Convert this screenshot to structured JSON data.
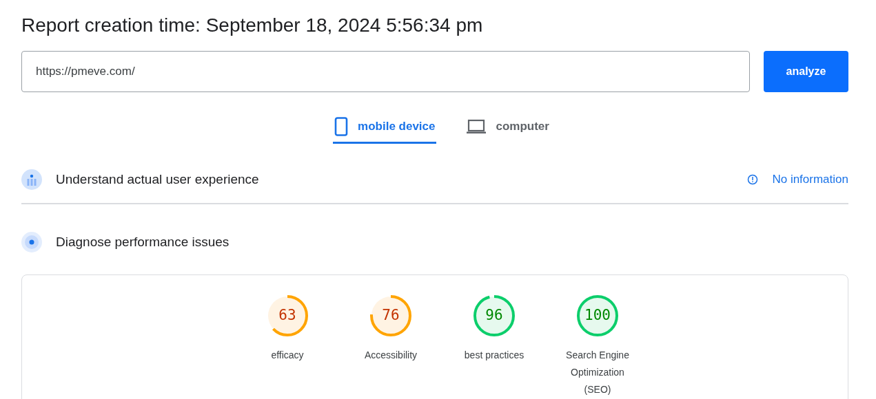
{
  "report_title": "Report creation time: September 18, 2024 5:56:34 pm",
  "url_field": {
    "value": "https://pmeve.com/"
  },
  "analyze_button": "analyze",
  "tabs": [
    {
      "label": "mobile device",
      "kind": "phone",
      "selected": true
    },
    {
      "label": "computer",
      "kind": "laptop",
      "selected": false
    }
  ],
  "sections": [
    {
      "title": "Understand actual user experience",
      "kind": "field",
      "status": "No information"
    },
    {
      "title": "Diagnose performance issues",
      "kind": "lab"
    }
  ],
  "scores": [
    {
      "score": "63",
      "label": "efficacy",
      "level": 0.63
    },
    {
      "score": "76",
      "label": "Accessibility",
      "level": 0.76
    },
    {
      "score": "96",
      "label": "best practices",
      "level": 0.96
    },
    {
      "score": "100",
      "label": "Search Engine Optimization (SEO)",
      "level": 1
    }
  ]
}
